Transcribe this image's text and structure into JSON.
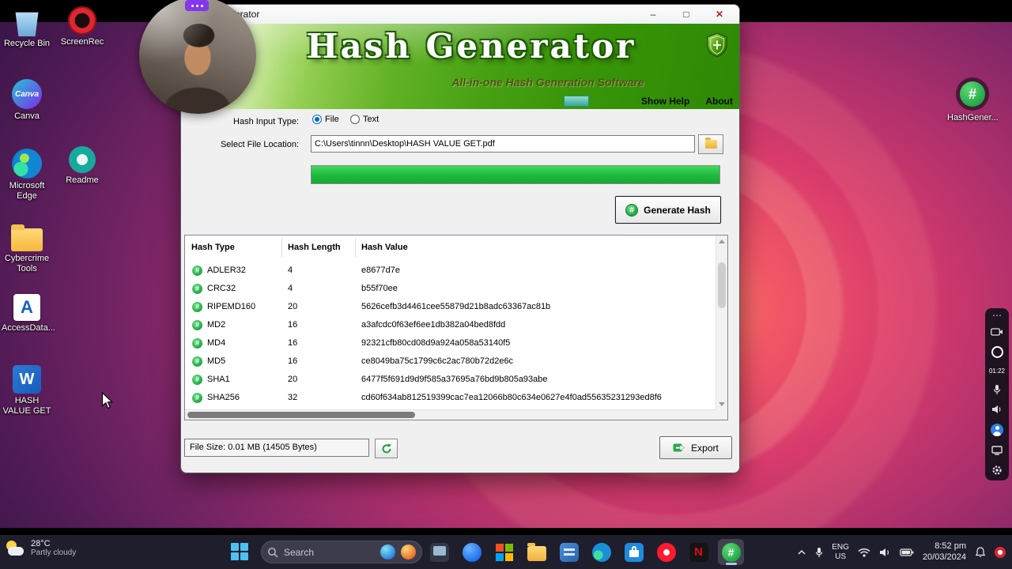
{
  "window": {
    "title": "erator",
    "controls": {
      "minimize": "–",
      "maximize": "□",
      "close": "✕"
    },
    "banner": {
      "title": "Hash Generator",
      "subtitle": "All-in-one Hash Generation Software",
      "menu": {
        "show_help": "Show Help",
        "about": "About"
      }
    },
    "form": {
      "input_type_label": "Hash Input Type:",
      "file_radio_label": "File",
      "text_radio_label": "Text",
      "input_type_selected": "File",
      "file_location_label": "Select File Location:",
      "file_path": "C:\\Users\\tinnn\\Desktop\\HASH VALUE GET.pdf",
      "progress_percent": 100,
      "generate_button": "Generate Hash"
    },
    "table": {
      "headers": {
        "type": "Hash Type",
        "length": "Hash Length",
        "value": "Hash Value"
      },
      "rows": [
        {
          "type": "ADLER32",
          "length": "4",
          "value": "e8677d7e"
        },
        {
          "type": "CRC32",
          "length": "4",
          "value": "b55f70ee"
        },
        {
          "type": "RIPEMD160",
          "length": "20",
          "value": "5626cefb3d4461cee55879d21b8adc63367ac81b"
        },
        {
          "type": "MD2",
          "length": "16",
          "value": "a3afcdc0f63ef6ee1db382a04bed8fdd"
        },
        {
          "type": "MD4",
          "length": "16",
          "value": "92321cfb80cd08d9a924a058a53140f5"
        },
        {
          "type": "MD5",
          "length": "16",
          "value": "ce8049ba75c1799c6c2ac780b72d2e6c"
        },
        {
          "type": "SHA1",
          "length": "20",
          "value": "6477f5f691d9d9f585a37695a76bd9b805a93abe"
        },
        {
          "type": "SHA256",
          "length": "32",
          "value": "cd60f634ab812519399cac7ea12066b80c634e0627e4f0ad55635231293ed8f6"
        }
      ]
    },
    "footer": {
      "file_size": "File Size: 0.01 MB (14505 Bytes)",
      "export_button": "Export"
    }
  },
  "desktop": {
    "icons_left": [
      {
        "label": "Recycle Bin",
        "kind": "recycle"
      },
      {
        "label": "ScreenRec",
        "kind": "screenrec"
      },
      {
        "label": "Canva",
        "kind": "canva"
      },
      {
        "label": "Microsoft Edge",
        "kind": "edge"
      },
      {
        "label": "Readme",
        "kind": "readme"
      },
      {
        "label": "Cybercrime Tools",
        "kind": "folder"
      },
      {
        "label": "AccessData...",
        "kind": "accessdata"
      },
      {
        "label": "HASH VALUE GET",
        "kind": "word"
      }
    ],
    "icon_right": {
      "label": "HashGener...",
      "kind": "hash"
    }
  },
  "recorder": {
    "timer": "01:22"
  },
  "taskbar": {
    "weather": {
      "temp": "28°C",
      "desc": "Partly cloudy"
    },
    "search_label": "Search",
    "apps": [
      {
        "kind": "pc"
      },
      {
        "kind": "msg"
      },
      {
        "kind": "office"
      },
      {
        "kind": "explorer"
      },
      {
        "kind": "code"
      },
      {
        "kind": "edgeb"
      },
      {
        "kind": "store"
      },
      {
        "kind": "opera"
      },
      {
        "kind": "netflix"
      },
      {
        "kind": "hashgen",
        "active": true
      }
    ],
    "tray": {
      "lang_top": "ENG",
      "lang_bottom": "US",
      "time": "8:52 pm",
      "date": "20/03/2024"
    }
  },
  "colors": {
    "accent_green": "#1ea644",
    "banner_green": "#46a012",
    "progress_green": "#1db93c",
    "taskbar_bg": "#1e1e2d",
    "desktop_magenta": "#d83b6c"
  }
}
